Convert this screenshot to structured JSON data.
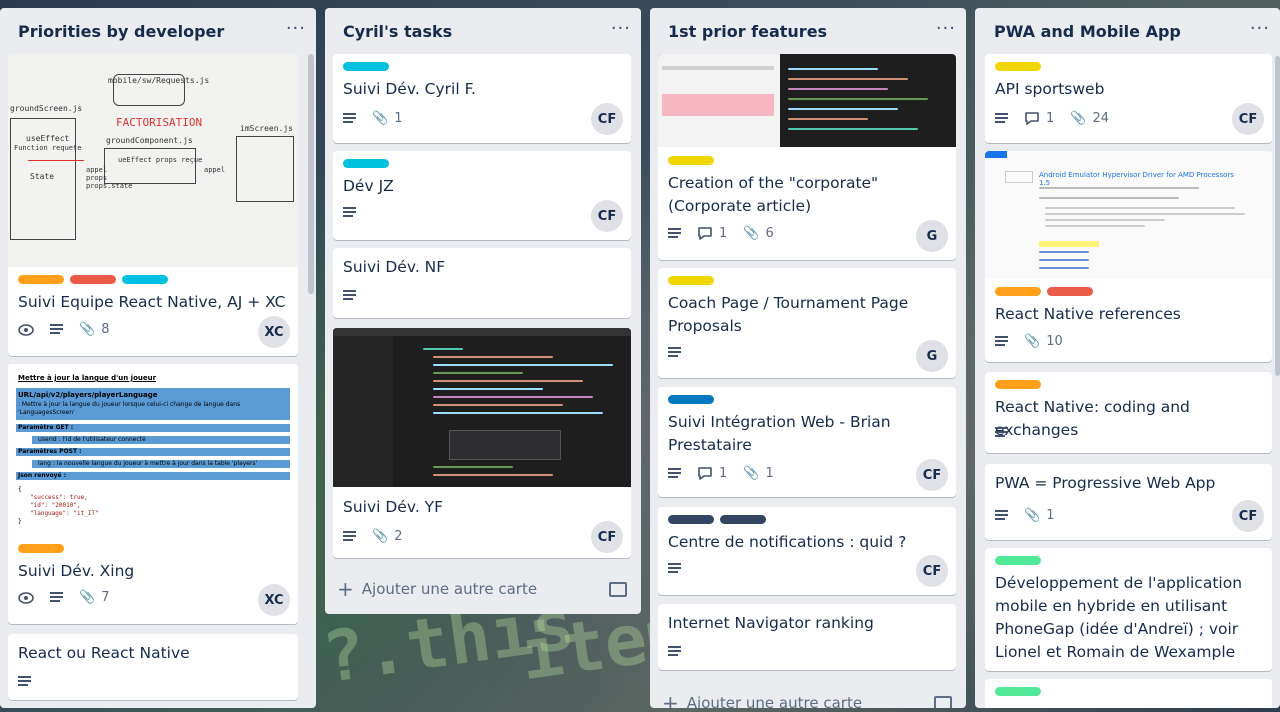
{
  "colors": {
    "yellow": "#f2d600",
    "orange": "#ff9f1a",
    "red": "#eb5a46",
    "sky": "#00c2e0",
    "blue": "#0079bf",
    "black": "#344563",
    "lime": "#51e898"
  },
  "background": {
    "code_text_1": "?.this",
    "code_text_2": "items"
  },
  "lists": [
    {
      "title": "Priorities by developer",
      "menu": "···",
      "cards": [
        {
          "labels": [
            "orange",
            "red",
            "sky"
          ],
          "title": "Suivi Equipe React Native, AJ + XC",
          "attachments": "8",
          "member": "XC",
          "cover_texts": [
            "mobile/sw/Requests.js",
            "FACTORISATION",
            "groundScreen.js",
            "groundComponent.js",
            "imScreen.js",
            "useEffect",
            "Function requete",
            "State",
            "ueEffect props reçue",
            "appel",
            "appel",
            "props",
            "props.state"
          ]
        },
        {
          "labels": [
            "orange"
          ],
          "title": "Suivi Dév. Xing",
          "attachments": "7",
          "member": "XC",
          "cover_texts": [
            "Mettre à jour la langue d'un joueur",
            "URL/api/v2/players/playerLanguage",
            ": Mettre à jour la langue du joueur lorsque celui-ci change de langue dans 'LanguagesScreen'",
            "Paramètre GET :",
            "userId : l'id de l'utilisateur connecté",
            "Paramètres POST :",
            "lang : la nouvelle langue du joueur à mettre à jour dans la table 'players'",
            "Json renvoyé :",
            "{",
            "\"success\": true,",
            "\"id\": \"20010\",",
            "\"language\": \"it_IT\"",
            "}"
          ]
        },
        {
          "labels": [],
          "title": "React ou React Native"
        }
      ]
    },
    {
      "title": "Cyril's tasks",
      "menu": "···",
      "cards": [
        {
          "labels": [
            "sky"
          ],
          "title": "Suivi Dév. Cyril F.",
          "attachments": "1",
          "member": "CF"
        },
        {
          "labels": [
            "sky"
          ],
          "title": "Dév JZ",
          "member": "CF"
        },
        {
          "labels": [],
          "title": "Suivi Dév. NF"
        },
        {
          "labels": [],
          "title": "Suivi Dév. YF",
          "attachments": "2",
          "member": "CF"
        }
      ],
      "add_card": "Ajouter une autre carte"
    },
    {
      "title": "1st prior features",
      "menu": "···",
      "cards": [
        {
          "labels": [
            "yellow"
          ],
          "title": "Creation of the \"corporate\" (Corporate article)",
          "comments": "1",
          "attachments": "6",
          "member": "G"
        },
        {
          "labels": [
            "yellow"
          ],
          "title": "Coach Page / Tournament Page Proposals",
          "member": "G"
        },
        {
          "labels": [
            "blue"
          ],
          "title": "Suivi Intégration Web - Brian Prestataire",
          "comments": "1",
          "attachments": "1",
          "member": "CF"
        },
        {
          "labels": [
            "black",
            "black"
          ],
          "title": "Centre de notifications : quid ?",
          "member": "CF"
        },
        {
          "labels": [],
          "title": "Internet Navigator ranking"
        }
      ],
      "add_card": "Ajouter une autre carte"
    },
    {
      "title": "PWA and Mobile App",
      "menu": "···",
      "cards": [
        {
          "labels": [
            "yellow"
          ],
          "title": "API sportsweb",
          "comments": "1",
          "attachments": "24",
          "member": "CF"
        },
        {
          "labels": [
            "orange",
            "red"
          ],
          "title": "React Native references",
          "attachments": "10",
          "cover_texts": [
            "Android Emulator Hypervisor Driver for AMD Processors 1.5"
          ]
        },
        {
          "labels": [
            "orange"
          ],
          "title": "React Native: coding and exchanges"
        },
        {
          "labels": [],
          "title": "PWA = Progressive Web App",
          "attachments": "1",
          "member": "CF"
        },
        {
          "labels": [
            "lime"
          ],
          "title": "Développement de l'application mobile en hybride en utilisant PhoneGap (idée d'Andreï) ; voir Lionel et Romain de Wexample"
        },
        {
          "labels": [
            "lime"
          ]
        }
      ]
    }
  ]
}
